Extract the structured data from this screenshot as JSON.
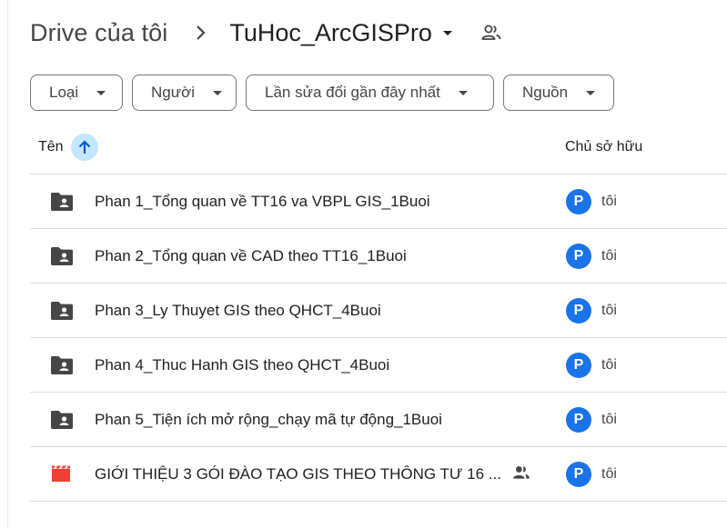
{
  "breadcrumb": {
    "root": "Drive của tôi",
    "current": "TuHoc_ArcGISPro"
  },
  "filters": [
    {
      "label": "Loại"
    },
    {
      "label": "Người"
    },
    {
      "label": "Lần sửa đổi gần đây nhất"
    },
    {
      "label": "Nguồn"
    }
  ],
  "table": {
    "headers": {
      "name": "Tên",
      "owner": "Chủ sở hữu"
    },
    "rows": [
      {
        "name": "Phan 1_Tổng quan về TT16 va VBPL GIS_1Buoi",
        "type": "shared-folder",
        "owner": "tôi",
        "avatar": "P",
        "shared": false
      },
      {
        "name": "Phan 2_Tổng quan về CAD theo TT16_1Buoi",
        "type": "shared-folder",
        "owner": "tôi",
        "avatar": "P",
        "shared": false
      },
      {
        "name": "Phan 3_Ly Thuyet GIS theo QHCT_4Buoi",
        "type": "shared-folder",
        "owner": "tôi",
        "avatar": "P",
        "shared": false
      },
      {
        "name": "Phan 4_Thuc Hanh GIS theo QHCT_4Buoi",
        "type": "shared-folder",
        "owner": "tôi",
        "avatar": "P",
        "shared": false
      },
      {
        "name": "Phan 5_Tiện ích mở rộng_chạy mã tự động_1Buoi",
        "type": "shared-folder",
        "owner": "tôi",
        "avatar": "P",
        "shared": false
      },
      {
        "name": "GIỚI THIỆU 3 GÓI ĐÀO TẠO GIS THEO THÔNG TƯ 16 ...",
        "type": "video",
        "owner": "tôi",
        "avatar": "P",
        "shared": true
      }
    ]
  },
  "colors": {
    "accent": "#c2e7ff",
    "avatar": "#1a73e8",
    "video": "#ea4335",
    "folder": "#444746"
  }
}
